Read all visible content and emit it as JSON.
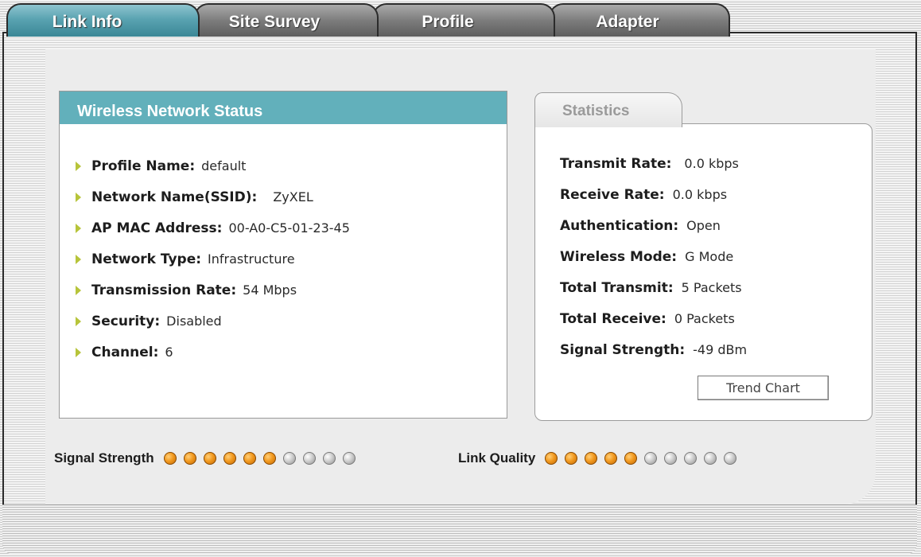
{
  "tabs": [
    {
      "label": "Link Info",
      "active": true
    },
    {
      "label": "Site Survey",
      "active": false
    },
    {
      "label": "Profile",
      "active": false
    },
    {
      "label": "Adapter",
      "active": false
    }
  ],
  "wireless_status": {
    "title": "Wireless Network Status",
    "rows": [
      {
        "label": "Profile Name:",
        "value": "default"
      },
      {
        "label": "Network Name(SSID):",
        "value": "ZyXEL"
      },
      {
        "label": "AP MAC Address:",
        "value": "00-A0-C5-01-23-45"
      },
      {
        "label": "Network Type:",
        "value": "Infrastructure"
      },
      {
        "label": "Transmission Rate:",
        "value": "54 Mbps"
      },
      {
        "label": "Security:",
        "value": "Disabled"
      },
      {
        "label": "Channel:",
        "value": "6"
      }
    ]
  },
  "statistics": {
    "tab_label": "Statistics",
    "rows": [
      {
        "label": "Transmit Rate:",
        "value": "0.0 kbps"
      },
      {
        "label": "Receive Rate:",
        "value": "0.0 kbps"
      },
      {
        "label": "Authentication:",
        "value": "Open"
      },
      {
        "label": "Wireless Mode:",
        "value": "G Mode"
      },
      {
        "label": "Total Transmit:",
        "value": "5 Packets"
      },
      {
        "label": "Total Receive:",
        "value": "0 Packets"
      },
      {
        "label": "Signal Strength:",
        "value": "-49 dBm"
      }
    ],
    "trend_button": "Trend Chart"
  },
  "indicators": {
    "signal_strength": {
      "label": "Signal Strength",
      "lit": 6,
      "total": 10
    },
    "link_quality": {
      "label": "Link Quality",
      "lit": 5,
      "total": 10
    }
  },
  "colors": {
    "accent": "#62b0bb",
    "led_on": "#f29a20",
    "led_off": "#c9c9c9",
    "bullet": "#b7c43a"
  }
}
